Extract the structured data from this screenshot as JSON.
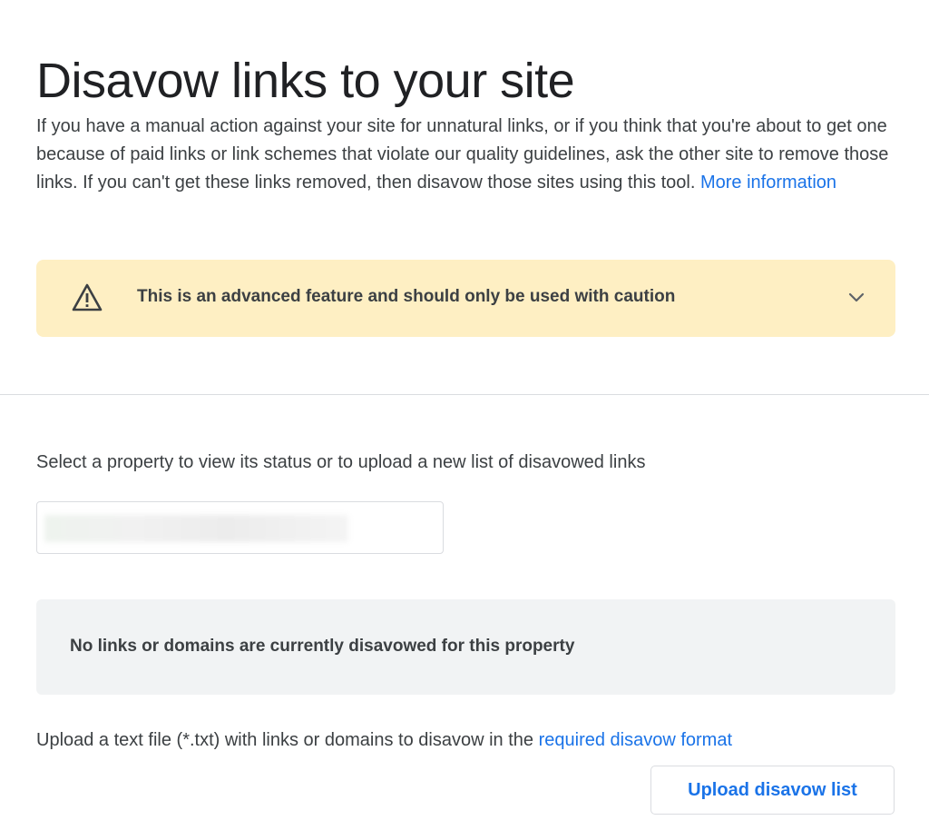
{
  "page": {
    "title": "Disavow links to your site"
  },
  "intro": {
    "text": "If you have a manual action against your site for unnatural links, or if you think that you're about to get one because of paid links or link schemes that violate our quality guidelines, ask the other site to remove those links. If you can't get these links removed, then disavow those sites using this tool.",
    "more_link": "More information"
  },
  "warning": {
    "icon": "warning-triangle-icon",
    "text": "This is an advanced feature and should only be used with caution",
    "expand_icon": "chevron-down-icon",
    "background": "#feefc3"
  },
  "property": {
    "label": "Select a property to view its status or to upload a new list of disavowed links",
    "selected_value_redacted": true
  },
  "status": {
    "text": "No links or domains are currently disavowed for this property"
  },
  "upload": {
    "text": "Upload a text file (*.txt) with links or domains to disavow in the",
    "format_link": "required disavow format",
    "button_label": "Upload disavow list"
  },
  "colors": {
    "link": "#1a73e8",
    "text": "#3c4043",
    "title": "#202124",
    "divider": "#dadce0",
    "status_bg": "#f1f3f4"
  }
}
